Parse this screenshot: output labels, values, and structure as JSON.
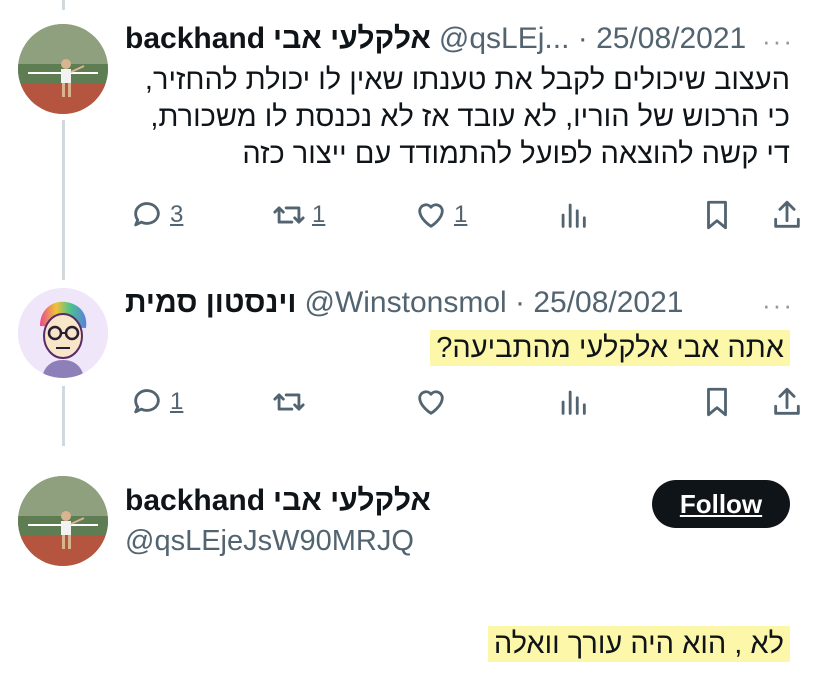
{
  "tweets": [
    {
      "name_latin": "backhand",
      "name_hebrew": "אלקלעי אבי",
      "meta": "@qsLEj... · 25/08/2021",
      "more": "···",
      "lines": [
        "העצוב שיכולים לקבל את טענתו שאין לו יכולת להחזיר,",
        "כי הרכוש של הוריו, לא עובד אז לא נכנסת לו משכורת,",
        "די קשה להוצאה לפועל להתמודד עם ייצור כזה"
      ],
      "actions": {
        "replies": "3",
        "retweets": "1",
        "likes": "1"
      }
    },
    {
      "name_hebrew": "וינסטון סמית",
      "meta": "@Winstonsmol · 25/08/2021",
      "more": "···",
      "text": "אתה אבי אלקלעי מהתביעה?",
      "actions": {
        "replies": "1",
        "retweets": "",
        "likes": ""
      }
    }
  ],
  "main": {
    "name_latin": "backhand",
    "name_hebrew": "אלקלעי אבי",
    "handle": "@qsLEjeJsW90MRJQ",
    "follow_label": "Follow",
    "text": "לא , הוא היה עורך וואלה"
  },
  "colors": {
    "highlight": "#fdf7a9",
    "text": "#0f1419",
    "muted": "#536471",
    "line": "#cfd9de"
  }
}
